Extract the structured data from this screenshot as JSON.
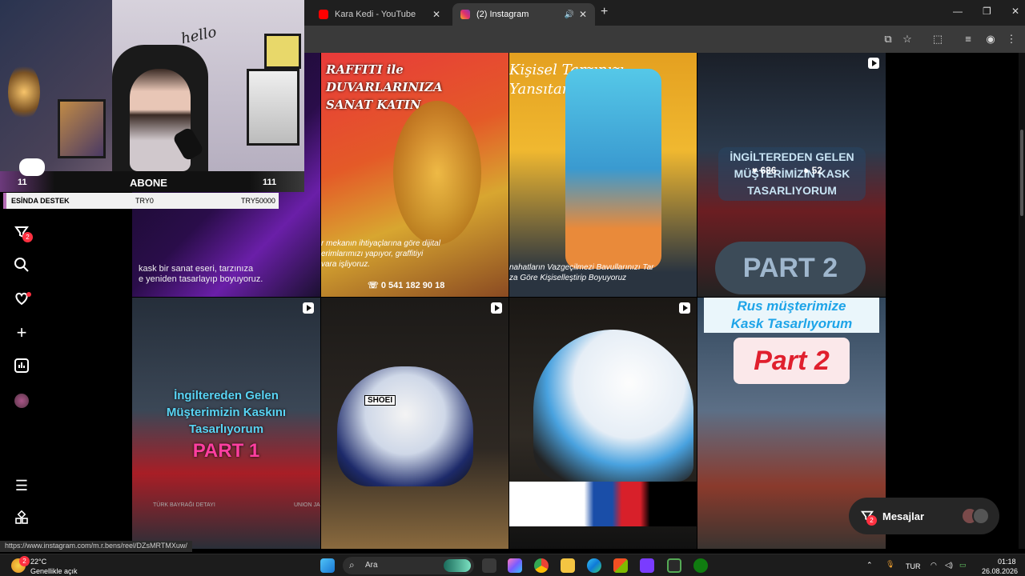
{
  "browser": {
    "tabs": [
      {
        "label": "Kara Kedi - YouTube",
        "active": false
      },
      {
        "label": "(2) Instagram",
        "active": true
      }
    ]
  },
  "sidebar": {
    "notif_count": "2",
    "icons": [
      "filter-icon",
      "search-icon",
      "heart-icon",
      "plus-icon",
      "chart-icon",
      "avatar",
      "menu-icon",
      "more-icon"
    ]
  },
  "posts": [
    {
      "text": "kask bir sanat eseri, tarzınıza\ne yeniden tasarlayıp boyuyoruz."
    },
    {
      "title": "RAFFITI ile DUVARLARINIZA\nSANAT KATIN",
      "body": "r mekanın ihtiyaçlarına göre dijital\nerimlarımızı yapıyor, graffitiyi\nvara işliyoruz.",
      "phone": "0 541 182 90 18"
    },
    {
      "title": "Kişisel Tarzınızı\nYansıtan Bavullar!",
      "body": "nahatların Vazgeçilmezi Bavullarınızı Tar\nza Göre Kişiselleştirip Boyuyoruz"
    },
    {
      "title": "İNGİLTEREDEN GELEN\nMÜŞTERİMİZİN KASK\nTASARLIYORUM",
      "likes": "686",
      "comments": "52",
      "part": "PART 2"
    },
    {
      "title": "İngiltereden Gelen\nMüşterimizin Kaskını\nTasarlıyorum",
      "part": "PART 1",
      "cap1": "TÜRK BAYRAĞI DETAYI",
      "cap2": "UNION JA"
    },
    {
      "brand": "SHOEI"
    },
    {},
    {
      "title": "Rus müşterimize\nKask Tasarlıyorum",
      "part": "Part 2"
    }
  ],
  "messages": {
    "label": "Mesajlar",
    "count": "2"
  },
  "status_url": "https://www.instagram.com/m.r.bens/reel/DZsMRTMXuw/",
  "stream": {
    "hello": "hello",
    "count_left": "11",
    "abone": "ABONE",
    "count_right": "111",
    "destek": "ESİNDA DESTEK",
    "try_min": "TRY0",
    "try_max": "TRY50000"
  },
  "taskbar": {
    "weather_temp": "22°C",
    "weather_desc": "Genellikle açık",
    "weather_badge": "2",
    "search": "Ara",
    "lang": "TUR",
    "time": "01:18",
    "date": "26.08.2026"
  },
  "colors": {
    "accent_red": "#ff3040",
    "instagram_pink": "#e1306c",
    "youtube_red": "#ff0000"
  }
}
